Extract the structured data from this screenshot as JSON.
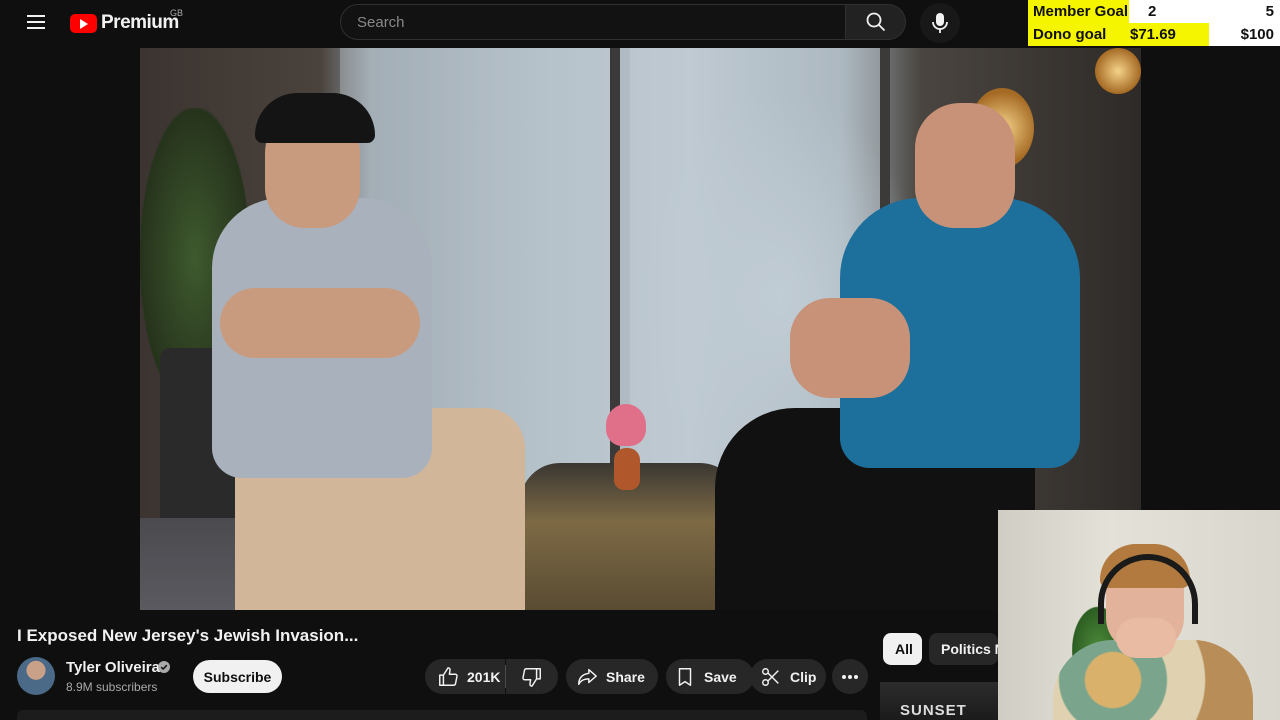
{
  "header": {
    "logo_text": "Premium",
    "region": "GB",
    "search_placeholder": "Search"
  },
  "goal_overlay": {
    "member": {
      "label": "Member Goal",
      "current": "2",
      "target": "5",
      "progress": 0.4
    },
    "dono": {
      "label": "Dono goal",
      "current": "$71.69",
      "target": "$100",
      "progress": 0.7169
    },
    "fill_color": "#f5f500"
  },
  "video": {
    "title": "I Exposed New Jersey's Jewish Invasion...",
    "channel": {
      "name": "Tyler Oliveira",
      "subscribers": "8.9M subscribers",
      "verified": true
    },
    "subscribe_label": "Subscribe",
    "actions": {
      "likes": "201K",
      "share": "Share",
      "save": "Save",
      "clip": "Clip"
    }
  },
  "chips": [
    "All",
    "Politics N"
  ],
  "recommended": {
    "thumb_text": "SUNSET"
  },
  "icons": {
    "menu": "hamburger-icon",
    "search": "search-icon",
    "mic": "microphone-icon",
    "like": "thumbs-up-icon",
    "dislike": "thumbs-down-icon",
    "share": "share-arrow-icon",
    "save": "bookmark-icon",
    "clip": "scissors-icon",
    "more": "more-horizontal-icon",
    "verified": "verified-check-icon"
  },
  "colors": {
    "background": "#0f0f0f",
    "brand_red": "#ff0000",
    "pill_bg": "#272727"
  }
}
